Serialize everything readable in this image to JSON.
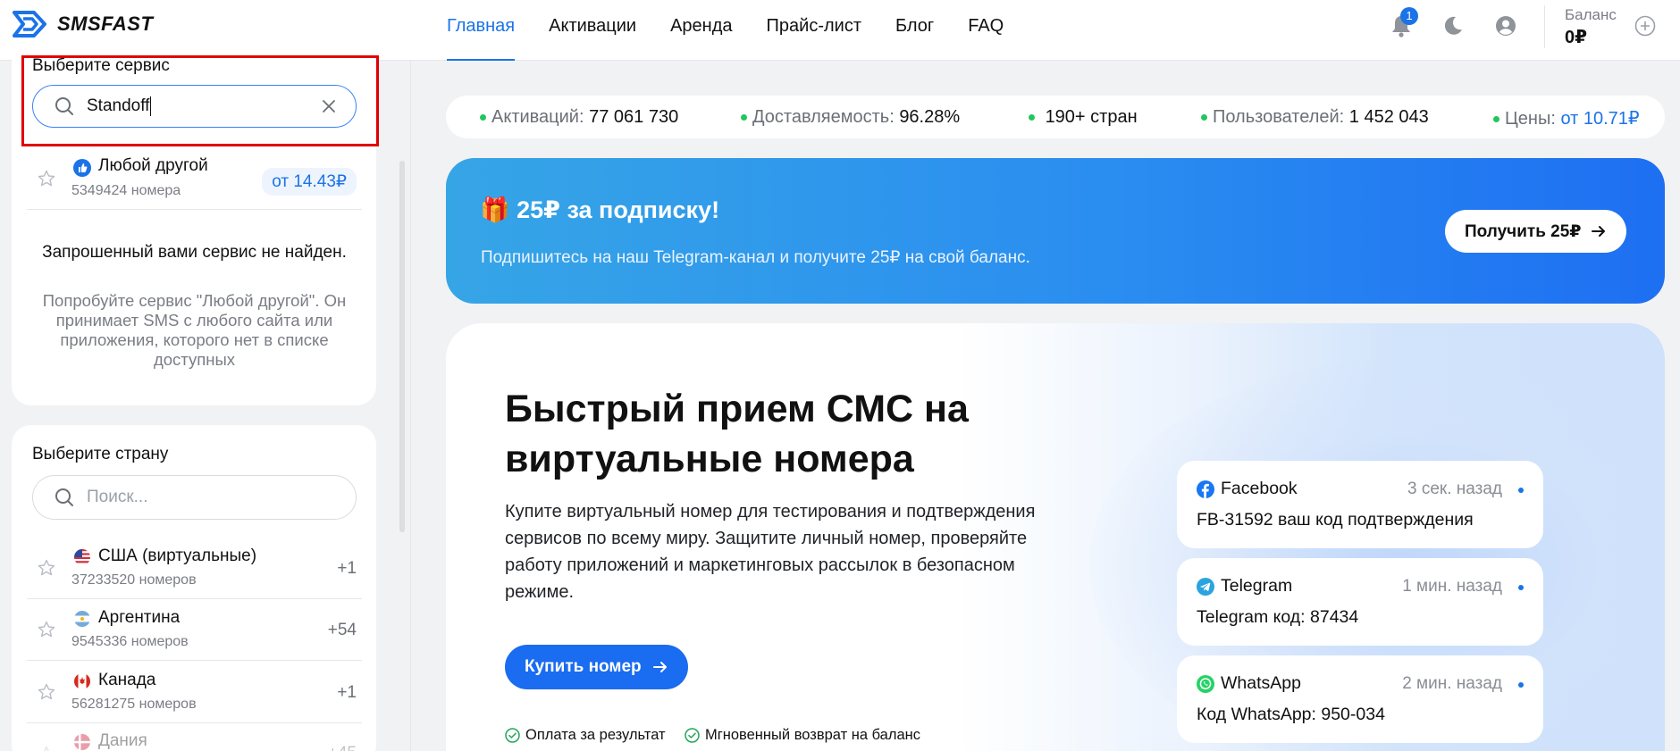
{
  "header": {
    "logo_text": "SMSFAST",
    "nav": [
      "Главная",
      "Активации",
      "Аренда",
      "Прайс-лист",
      "Блог",
      "FAQ"
    ],
    "notification_count": "1",
    "balance_label": "Баланс",
    "balance_value": "0₽"
  },
  "sidebar": {
    "service": {
      "title": "Выберите сервис",
      "search_value": "Standoff",
      "item": {
        "name": "Любой другой",
        "sub": "5349424 номера",
        "price": "от 14.43₽"
      },
      "not_found_title": "Запрошенный вами сервис не найден.",
      "not_found_desc": "Попробуйте сервис \"Любой другой\". Он принимает SMS с любого сайта или приложения, которого нет в списке доступных"
    },
    "country": {
      "title": "Выберите страну",
      "search_placeholder": "Поиск...",
      "items": [
        {
          "name": "США (виртуальные)",
          "sub": "37233520 номеров",
          "count": "+1",
          "flag": "us"
        },
        {
          "name": "Аргентина",
          "sub": "9545336 номеров",
          "count": "+54",
          "flag": "ar"
        },
        {
          "name": "Канада",
          "sub": "56281275 номеров",
          "count": "+1",
          "flag": "ca"
        },
        {
          "name": "Дания",
          "sub": "",
          "count": "+45",
          "flag": "dk"
        }
      ]
    }
  },
  "stats": [
    {
      "label": "Активаций:",
      "value": "77 061 730"
    },
    {
      "label": "Доставляемость:",
      "value": "96.28%"
    },
    {
      "label": "",
      "value": "190+ стран"
    },
    {
      "label": "Пользователей:",
      "value": "1 452 043"
    },
    {
      "label": "Цены:",
      "value": "от 10.71₽"
    }
  ],
  "promo": {
    "title": "25₽ за подписку!",
    "subtitle": "Подпишитесь на наш Telegram-канал и получите 25₽ на свой баланс.",
    "button": "Получить 25₽"
  },
  "hero": {
    "title": "Быстрый прием СМС на виртуальные номера",
    "description": "Купите виртуальный номер для тестирования и подтверждения сервисов по всему миру. Защитите личный номер, проверяйте работу приложений и маркетинговых рассылок в безопасном режиме.",
    "button": "Купить номер",
    "features": [
      "Оплата за результат",
      "Мгновенный возврат на баланс"
    ],
    "messages": [
      {
        "app": "Facebook",
        "time": "3 сек. назад",
        "text": "FB-31592 ваш код подтверждения",
        "icon": "facebook-icon"
      },
      {
        "app": "Telegram",
        "time": "1 мин. назад",
        "text": "Telegram код: 87434",
        "icon": "telegram-icon"
      },
      {
        "app": "WhatsApp",
        "time": "2 мин. назад",
        "text": "Код WhatsApp: 950-034",
        "icon": "whatsapp-icon"
      }
    ]
  },
  "colors": {
    "accent": "#1a73e8",
    "highlight": "#e00000",
    "status_green": "#22c55e"
  }
}
